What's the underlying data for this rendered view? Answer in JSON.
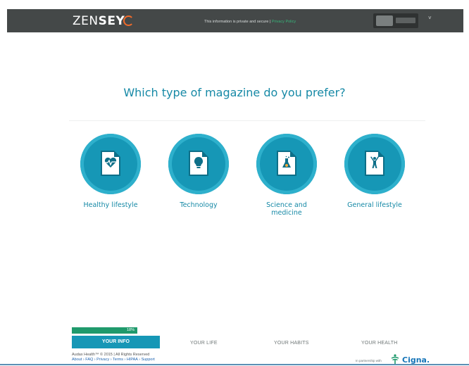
{
  "header": {
    "brand_prefix": "ZEN",
    "brand_bold": "SEY",
    "secure_text": "This information is private and secure |",
    "secure_link": "Privacy Policy",
    "chevron": "˅"
  },
  "question": "Which type of magazine do you prefer?",
  "options": [
    {
      "label": "Healthy lifestyle",
      "icon": "heart-pulse-icon"
    },
    {
      "label": "Technology",
      "icon": "lightbulb-icon"
    },
    {
      "label": "Science and medicine",
      "icon": "flask-icon"
    },
    {
      "label": "General lifestyle",
      "icon": "person-arms-up-icon"
    }
  ],
  "progress": {
    "percent": 18,
    "label": "18%"
  },
  "steps": {
    "active": "YOUR INFO",
    "life": "YOUR LIFE",
    "habits": "YOUR HABITS",
    "health": "YOUR HEALTH"
  },
  "footer": {
    "copyright": "Audax Health™ © 2015 | All Rights Reserved",
    "links": [
      "About",
      "FAQ",
      "Privacy",
      "Terms",
      "HIPAA",
      "Support"
    ],
    "partner_text": "In partnership with",
    "partner_name": "Cigna."
  },
  "colors": {
    "accent": "#1697b6",
    "topbar": "#444848",
    "progress": "#1f9a6c"
  }
}
